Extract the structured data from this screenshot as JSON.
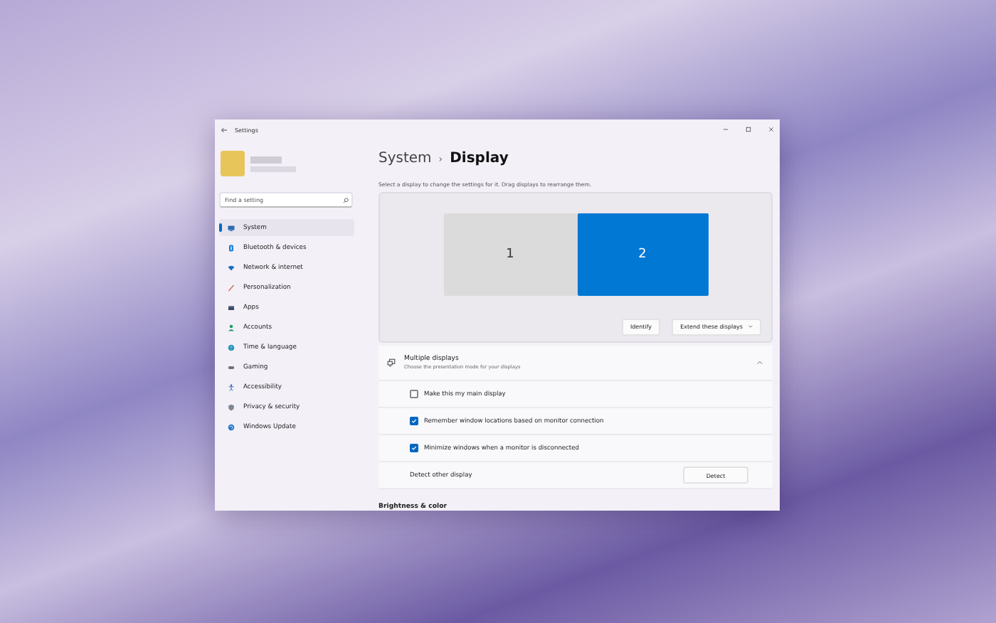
{
  "window": {
    "title": "Settings"
  },
  "search": {
    "placeholder": "Find a setting"
  },
  "sidebar": {
    "items": [
      {
        "label": "System",
        "selected": true
      },
      {
        "label": "Bluetooth & devices",
        "selected": false
      },
      {
        "label": "Network & internet",
        "selected": false
      },
      {
        "label": "Personalization",
        "selected": false
      },
      {
        "label": "Apps",
        "selected": false
      },
      {
        "label": "Accounts",
        "selected": false
      },
      {
        "label": "Time & language",
        "selected": false
      },
      {
        "label": "Gaming",
        "selected": false
      },
      {
        "label": "Accessibility",
        "selected": false
      },
      {
        "label": "Privacy & security",
        "selected": false
      },
      {
        "label": "Windows Update",
        "selected": false
      }
    ]
  },
  "breadcrumb": {
    "parent": "System",
    "separator": "›",
    "current": "Display"
  },
  "description": "Select a display to change the settings for it. Drag displays to rearrange them.",
  "displays": [
    {
      "label": "1",
      "selected": false
    },
    {
      "label": "2",
      "selected": true
    }
  ],
  "arrangement_buttons": {
    "identify": "Identify",
    "mode": "Extend these displays"
  },
  "multiple_displays": {
    "title": "Multiple displays",
    "subtitle": "Choose the presentation mode for your displays",
    "expanded": true,
    "options": [
      {
        "label": "Make this my main display",
        "checked": false
      },
      {
        "label": "Remember window locations based on monitor connection",
        "checked": true
      },
      {
        "label": "Minimize windows when a monitor is disconnected",
        "checked": true
      }
    ],
    "detect": {
      "label": "Detect other display",
      "button": "Detect"
    }
  },
  "next_section": "Brightness & color"
}
